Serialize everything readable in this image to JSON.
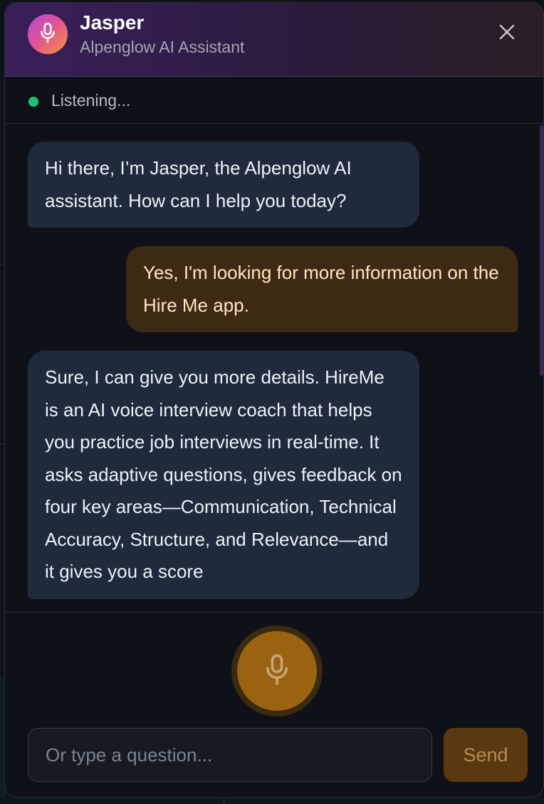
{
  "header": {
    "title": "Jasper",
    "subtitle": "Alpenglow AI Assistant",
    "avatar_icon": "microphone-icon",
    "close_icon": "close-icon"
  },
  "status": {
    "text": "Listening...",
    "dot_color": "#22c07a"
  },
  "messages": [
    {
      "role": "assistant",
      "text": "Hi there, I’m Jasper, the Alpenglow AI assistant. How can I help you today?"
    },
    {
      "role": "user",
      "text": "Yes, I'm looking for more information on the Hire Me app."
    },
    {
      "role": "assistant",
      "text": "Sure, I can give you more details. HireMe is an AI voice interview coach that helps you practice job interviews in real-time. It asks adaptive questions, gives feedback on four key areas—Communication, Technical Accuracy, Structure, and Relevance—and it gives you a score"
    }
  ],
  "composer": {
    "mic_icon": "microphone-icon",
    "input_value": "",
    "input_placeholder": "Or type a question...",
    "send_label": "Send"
  },
  "colors": {
    "accent": "#9a6310",
    "assistant_bubble": "#1f2a3c",
    "user_bubble": "#3d2a15"
  }
}
